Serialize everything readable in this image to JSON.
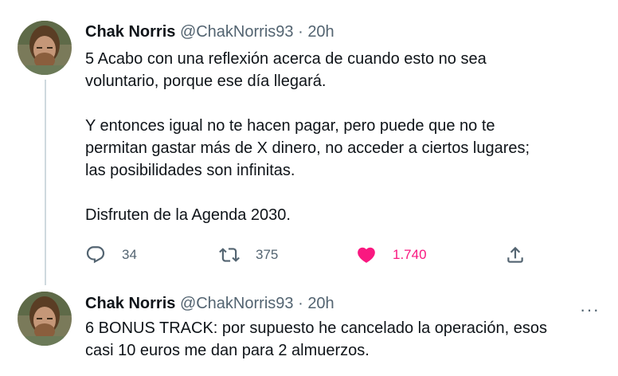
{
  "tweets": [
    {
      "author": {
        "name": "Chak Norris",
        "handle": "@ChakNorris93"
      },
      "time": "20h",
      "separator": "·",
      "paragraphs": [
        "5 Acabo con una reflexión acerca de cuando esto no sea",
        "voluntario, porque ese día llegará.",
        "",
        "Y entonces igual no te hacen pagar, pero puede que no te",
        "permitan gastar más de X dinero, no acceder a ciertos lugares;",
        "las posibilidades son infinitas.",
        "",
        "Disfruten de la Agenda 2030."
      ],
      "actions": {
        "reply_count": "34",
        "retweet_count": "375",
        "like_count": "1.740",
        "liked": true
      }
    },
    {
      "author": {
        "name": "Chak Norris",
        "handle": "@ChakNorris93"
      },
      "time": "20h",
      "separator": "·",
      "paragraphs": [
        "6 BONUS TRACK: por supuesto he cancelado la operación, esos",
        "casi 10 euros me dan para 2 almuerzos."
      ],
      "more_label": "···"
    }
  ],
  "colors": {
    "text": "#0f1419",
    "secondary": "#536471",
    "like": "#f91880",
    "thread_line": "#cfd9de"
  },
  "icons": [
    "reply-icon",
    "retweet-icon",
    "heart-icon",
    "share-icon",
    "more-icon"
  ]
}
